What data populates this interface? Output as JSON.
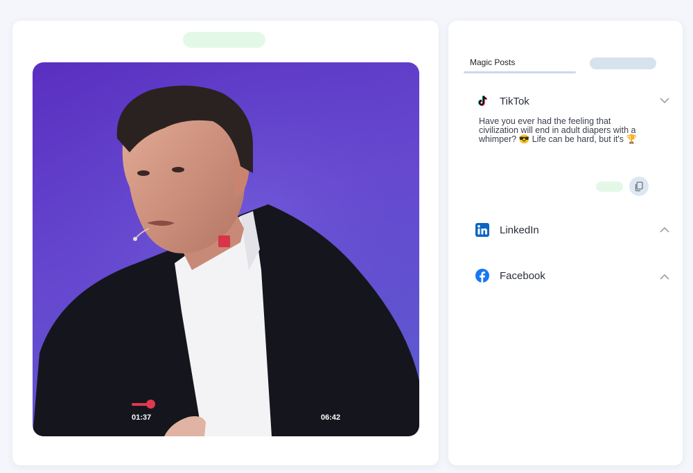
{
  "player": {
    "current_time": "01:37",
    "total_time": "06:42",
    "progress": 0.24
  },
  "panel": {
    "tabs": [
      {
        "label": "Magic Posts",
        "active": true
      }
    ],
    "platforms": [
      {
        "name": "TikTok",
        "icon": "tiktok-icon",
        "expanded": true,
        "post_text": "Have you ever had the feeling that civilization will end in adult diapers with a whimper? 😎 Life can be hard, but it's 🏆"
      },
      {
        "name": "LinkedIn",
        "icon": "linkedin-icon",
        "expanded": false
      },
      {
        "name": "Facebook",
        "icon": "facebook-icon",
        "expanded": false
      }
    ]
  },
  "colors": {
    "accent_red": "#e0384d",
    "pill_green": "#e4f8e8",
    "linkedin_blue": "#0a66c2",
    "facebook_blue": "#1877f2"
  }
}
